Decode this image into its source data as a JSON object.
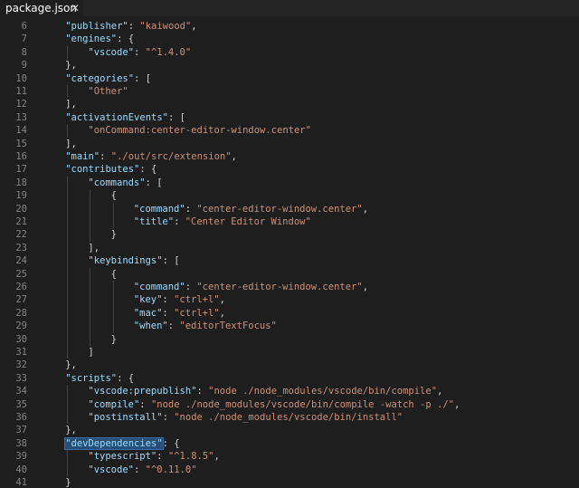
{
  "tab": {
    "label": "package.json",
    "close_glyph": "✕"
  },
  "lines": [
    {
      "n": "6",
      "indent": 1,
      "t": [
        [
          "key",
          "\"publisher\""
        ],
        [
          "punc",
          ": "
        ],
        [
          "str",
          "\"kaiwood\""
        ],
        [
          "punc",
          ","
        ]
      ]
    },
    {
      "n": "7",
      "indent": 1,
      "t": [
        [
          "key",
          "\"engines\""
        ],
        [
          "punc",
          ": {"
        ]
      ]
    },
    {
      "n": "8",
      "indent": 2,
      "t": [
        [
          "key",
          "\"vscode\""
        ],
        [
          "punc",
          ": "
        ],
        [
          "str",
          "\"^1.4.0\""
        ]
      ]
    },
    {
      "n": "9",
      "indent": 1,
      "t": [
        [
          "punc",
          "},"
        ]
      ]
    },
    {
      "n": "10",
      "indent": 1,
      "t": [
        [
          "key",
          "\"categories\""
        ],
        [
          "punc",
          ": ["
        ]
      ]
    },
    {
      "n": "11",
      "indent": 2,
      "t": [
        [
          "str",
          "\"Other\""
        ]
      ]
    },
    {
      "n": "12",
      "indent": 1,
      "t": [
        [
          "punc",
          "],"
        ]
      ]
    },
    {
      "n": "13",
      "indent": 1,
      "t": [
        [
          "key",
          "\"activationEvents\""
        ],
        [
          "punc",
          ": ["
        ]
      ]
    },
    {
      "n": "14",
      "indent": 2,
      "t": [
        [
          "str",
          "\"onCommand:center-editor-window.center\""
        ]
      ]
    },
    {
      "n": "15",
      "indent": 1,
      "t": [
        [
          "punc",
          "],"
        ]
      ]
    },
    {
      "n": "16",
      "indent": 1,
      "t": [
        [
          "key",
          "\"main\""
        ],
        [
          "punc",
          ": "
        ],
        [
          "str",
          "\"./out/src/extension\""
        ],
        [
          "punc",
          ","
        ]
      ]
    },
    {
      "n": "17",
      "indent": 1,
      "t": [
        [
          "key",
          "\"contributes\""
        ],
        [
          "punc",
          ": {"
        ]
      ]
    },
    {
      "n": "18",
      "indent": 2,
      "t": [
        [
          "key",
          "\"commands\""
        ],
        [
          "punc",
          ": ["
        ]
      ]
    },
    {
      "n": "19",
      "indent": 3,
      "t": [
        [
          "punc",
          "{"
        ]
      ]
    },
    {
      "n": "20",
      "indent": 4,
      "t": [
        [
          "key",
          "\"command\""
        ],
        [
          "punc",
          ": "
        ],
        [
          "str",
          "\"center-editor-window.center\""
        ],
        [
          "punc",
          ","
        ]
      ]
    },
    {
      "n": "21",
      "indent": 4,
      "t": [
        [
          "key",
          "\"title\""
        ],
        [
          "punc",
          ": "
        ],
        [
          "str",
          "\"Center Editor Window\""
        ]
      ]
    },
    {
      "n": "22",
      "indent": 3,
      "t": [
        [
          "punc",
          "}"
        ]
      ]
    },
    {
      "n": "23",
      "indent": 2,
      "t": [
        [
          "punc",
          "],"
        ]
      ]
    },
    {
      "n": "24",
      "indent": 2,
      "t": [
        [
          "key",
          "\"keybindings\""
        ],
        [
          "punc",
          ": ["
        ]
      ]
    },
    {
      "n": "25",
      "indent": 3,
      "t": [
        [
          "punc",
          "{"
        ]
      ]
    },
    {
      "n": "26",
      "indent": 4,
      "t": [
        [
          "key",
          "\"command\""
        ],
        [
          "punc",
          ": "
        ],
        [
          "str",
          "\"center-editor-window.center\""
        ],
        [
          "punc",
          ","
        ]
      ]
    },
    {
      "n": "27",
      "indent": 4,
      "t": [
        [
          "key",
          "\"key\""
        ],
        [
          "punc",
          ": "
        ],
        [
          "str",
          "\"ctrl+l\""
        ],
        [
          "punc",
          ","
        ]
      ]
    },
    {
      "n": "28",
      "indent": 4,
      "t": [
        [
          "key",
          "\"mac\""
        ],
        [
          "punc",
          ": "
        ],
        [
          "str",
          "\"ctrl+l\""
        ],
        [
          "punc",
          ","
        ]
      ]
    },
    {
      "n": "29",
      "indent": 4,
      "t": [
        [
          "key",
          "\"when\""
        ],
        [
          "punc",
          ": "
        ],
        [
          "str",
          "\"editorTextFocus\""
        ]
      ]
    },
    {
      "n": "30",
      "indent": 3,
      "t": [
        [
          "punc",
          "}"
        ]
      ]
    },
    {
      "n": "31",
      "indent": 2,
      "t": [
        [
          "punc",
          "]"
        ]
      ]
    },
    {
      "n": "32",
      "indent": 1,
      "t": [
        [
          "punc",
          "},"
        ]
      ]
    },
    {
      "n": "33",
      "indent": 1,
      "t": [
        [
          "key",
          "\"scripts\""
        ],
        [
          "punc",
          ": {"
        ]
      ]
    },
    {
      "n": "34",
      "indent": 2,
      "t": [
        [
          "key",
          "\"vscode:prepublish\""
        ],
        [
          "punc",
          ": "
        ],
        [
          "str",
          "\"node ./node_modules/vscode/bin/compile\""
        ],
        [
          "punc",
          ","
        ]
      ]
    },
    {
      "n": "35",
      "indent": 2,
      "t": [
        [
          "key",
          "\"compile\""
        ],
        [
          "punc",
          ": "
        ],
        [
          "str",
          "\"node ./node_modules/vscode/bin/compile -watch -p ./\""
        ],
        [
          "punc",
          ","
        ]
      ]
    },
    {
      "n": "36",
      "indent": 2,
      "t": [
        [
          "key",
          "\"postinstall\""
        ],
        [
          "punc",
          ": "
        ],
        [
          "str",
          "\"node ./node_modules/vscode/bin/install\""
        ]
      ]
    },
    {
      "n": "37",
      "indent": 1,
      "t": [
        [
          "punc",
          "},"
        ]
      ]
    },
    {
      "n": "38",
      "indent": 1,
      "t": [
        [
          "keyhl",
          "\"devDependencies\""
        ],
        [
          "punc",
          ": {"
        ]
      ]
    },
    {
      "n": "39",
      "indent": 2,
      "t": [
        [
          "key",
          "\"typescript\""
        ],
        [
          "punc",
          ": "
        ],
        [
          "str",
          "\"^1.8.5\""
        ],
        [
          "punc",
          ","
        ]
      ]
    },
    {
      "n": "40",
      "indent": 2,
      "t": [
        [
          "key",
          "\"vscode\""
        ],
        [
          "punc",
          ": "
        ],
        [
          "str",
          "\"^0.11.0\""
        ]
      ]
    },
    {
      "n": "41",
      "indent": 1,
      "t": [
        [
          "punc",
          "}"
        ]
      ]
    }
  ]
}
